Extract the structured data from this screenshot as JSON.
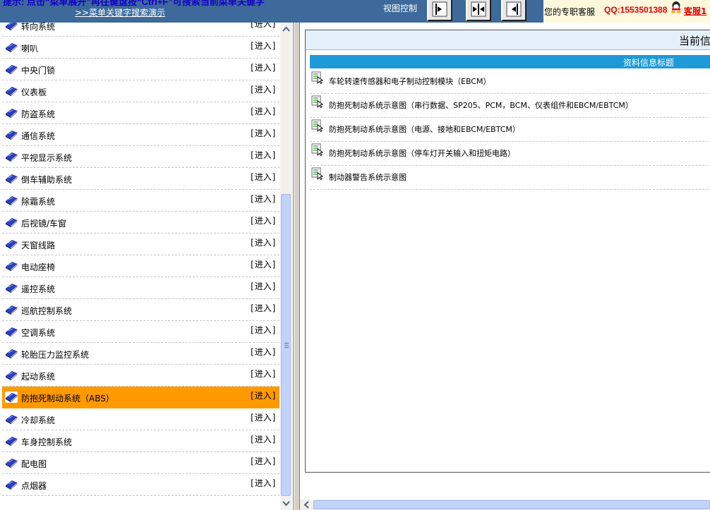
{
  "topbar": {
    "hint": "提示: 点击“菜单展开”再往键盘按“Ctrl+F”可搜索当前菜单关键字",
    "demo_link": ">>菜单关键字搜索演示",
    "view_control_label": "视图控制",
    "view_buttons": [
      "expand-right",
      "expand-both",
      "collapse-left"
    ],
    "support_label": "您的专职客服",
    "support_qq": "QQ:1553501388",
    "support_cs": "客服1"
  },
  "menu": {
    "enter_label": "[进入]",
    "items": [
      "转向系统",
      "喇叭",
      "中央门锁",
      "仪表板",
      "防盗系统",
      "通信系统",
      "平视显示系统",
      "倒车辅助系统",
      "除霜系统",
      "后视镜/车窗",
      "天窗线路",
      "电动座椅",
      "遥控系统",
      "巡航控制系统",
      "空调系统",
      "轮胎压力监控系统",
      "起动系统",
      "防抱死制动系统（ABS）",
      "冷却系统",
      "车身控制系统",
      "配电图",
      "点烟器"
    ],
    "active_index": 17
  },
  "content": {
    "panel_title": "当前信",
    "list_header": "资料信息标题",
    "documents": [
      "车轮转速传感器和电子制动控制模块（EBCM）",
      "防抱死制动系统示意图（串行数据、SP205、PCM，BCM、仪表组件和EBCM/EBTCM）",
      "防抱死制动系统示意图（电源、接地和EBCM/EBTCM）",
      "防抱死制动系统示意图（停车灯开关输入和扭矩电路）",
      "制动器警告系统示意图"
    ]
  },
  "colors": {
    "topbar_bg": "#3d6a9a",
    "active_row_bg": "#ff9900",
    "list_header_bg": "#1f9ad8",
    "support_text": "#e00000"
  }
}
